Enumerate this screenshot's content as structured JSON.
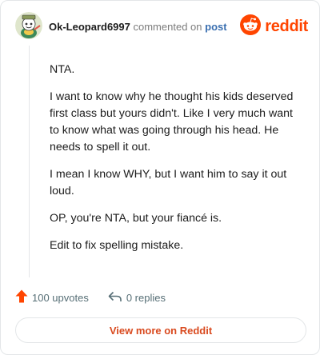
{
  "header": {
    "username": "Ok-Leopard6997",
    "action_text": "commented on",
    "post_link": "post",
    "brand": "reddit",
    "avatar_icon": "snoo-avatar-icon",
    "logo_icon": "reddit-snoo-icon",
    "brand_color": "#ff4500"
  },
  "comment": {
    "paragraphs": [
      "NTA.",
      "I want to know why he thought his kids deserved first class but yours didn't. Like I very much want to know what was going through his head. He needs to spell it out.",
      "I mean I know WHY, but I want him to say it out loud.",
      "OP, you're NTA, but your fiancé is.",
      "Edit to fix spelling mistake."
    ]
  },
  "footer": {
    "upvotes": "100 upvotes",
    "replies": "0 replies",
    "upvote_icon": "upvote-arrow-icon",
    "reply_icon": "reply-arrow-icon"
  },
  "cta": {
    "label": "View more on Reddit"
  }
}
